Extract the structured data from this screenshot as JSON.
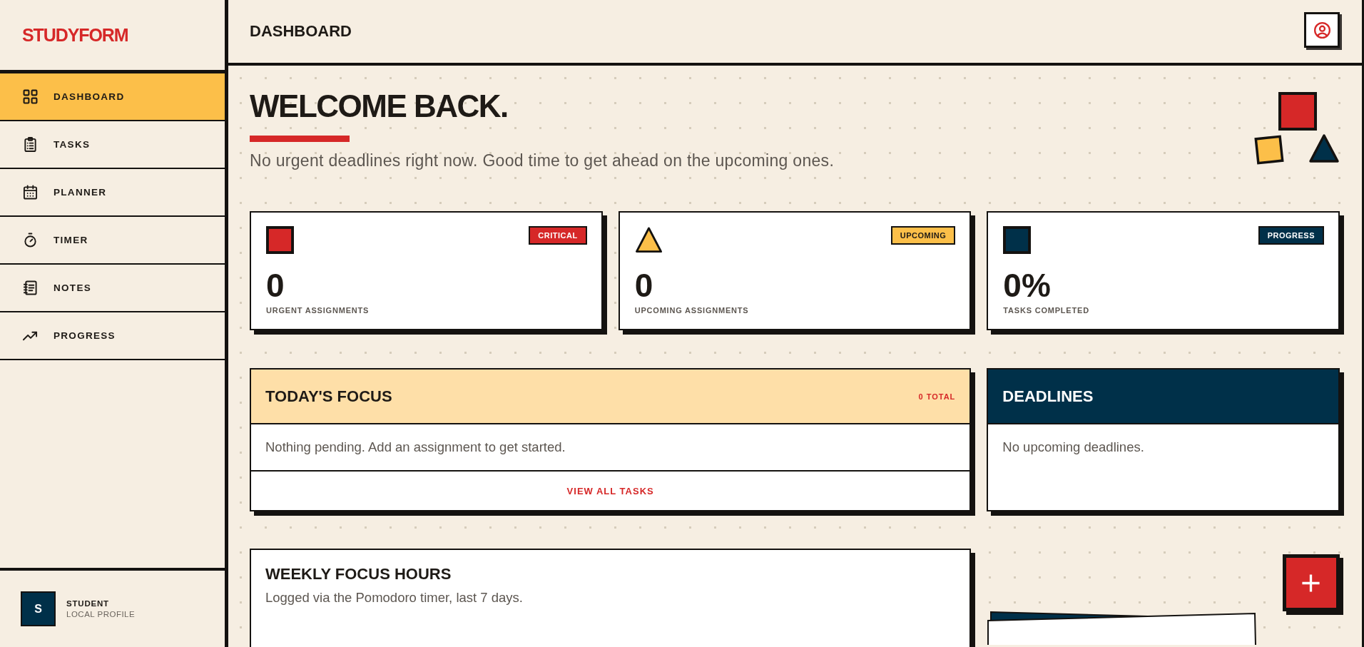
{
  "sidebar": {
    "logo": "STUDYFORM",
    "nav": [
      {
        "label": "DASHBOARD",
        "selected": true
      },
      {
        "label": "TASKS",
        "selected": false
      },
      {
        "label": "PLANNER",
        "selected": false
      },
      {
        "label": "TIMER",
        "selected": false
      },
      {
        "label": "NOTES",
        "selected": false
      },
      {
        "label": "PROGRESS",
        "selected": false
      }
    ],
    "profile": {
      "initial": "S",
      "name": "STUDENT",
      "subtitle": "LOCAL PROFILE"
    }
  },
  "header": {
    "title": "DASHBOARD"
  },
  "welcome": {
    "title": "WELCOME BACK.",
    "message": "No urgent deadlines right now. Good time to get ahead on the upcoming ones."
  },
  "stats": [
    {
      "badge": "CRITICAL",
      "color": "#d62828",
      "value": "0",
      "label": "URGENT ASSIGNMENTS"
    },
    {
      "badge": "UPCOMING",
      "color": "#fcbf49",
      "value": "0",
      "label": "UPCOMING ASSIGNMENTS"
    },
    {
      "badge": "PROGRESS",
      "color": "#003049",
      "value": "0%",
      "label": "TASKS COMPLETED"
    }
  ],
  "focus": {
    "title": "TODAY'S FOCUS",
    "count": "0 TOTAL",
    "empty_text": "Nothing pending. Add an assignment to get started.",
    "link": "VIEW ALL TASKS"
  },
  "deadlines": {
    "title": "DEADLINES",
    "empty_text": "No upcoming deadlines."
  },
  "weekly_focus": {
    "title": "WEEKLY FOCUS HOURS",
    "subtitle": "Logged via the Pomodoro timer, last 7 days."
  }
}
